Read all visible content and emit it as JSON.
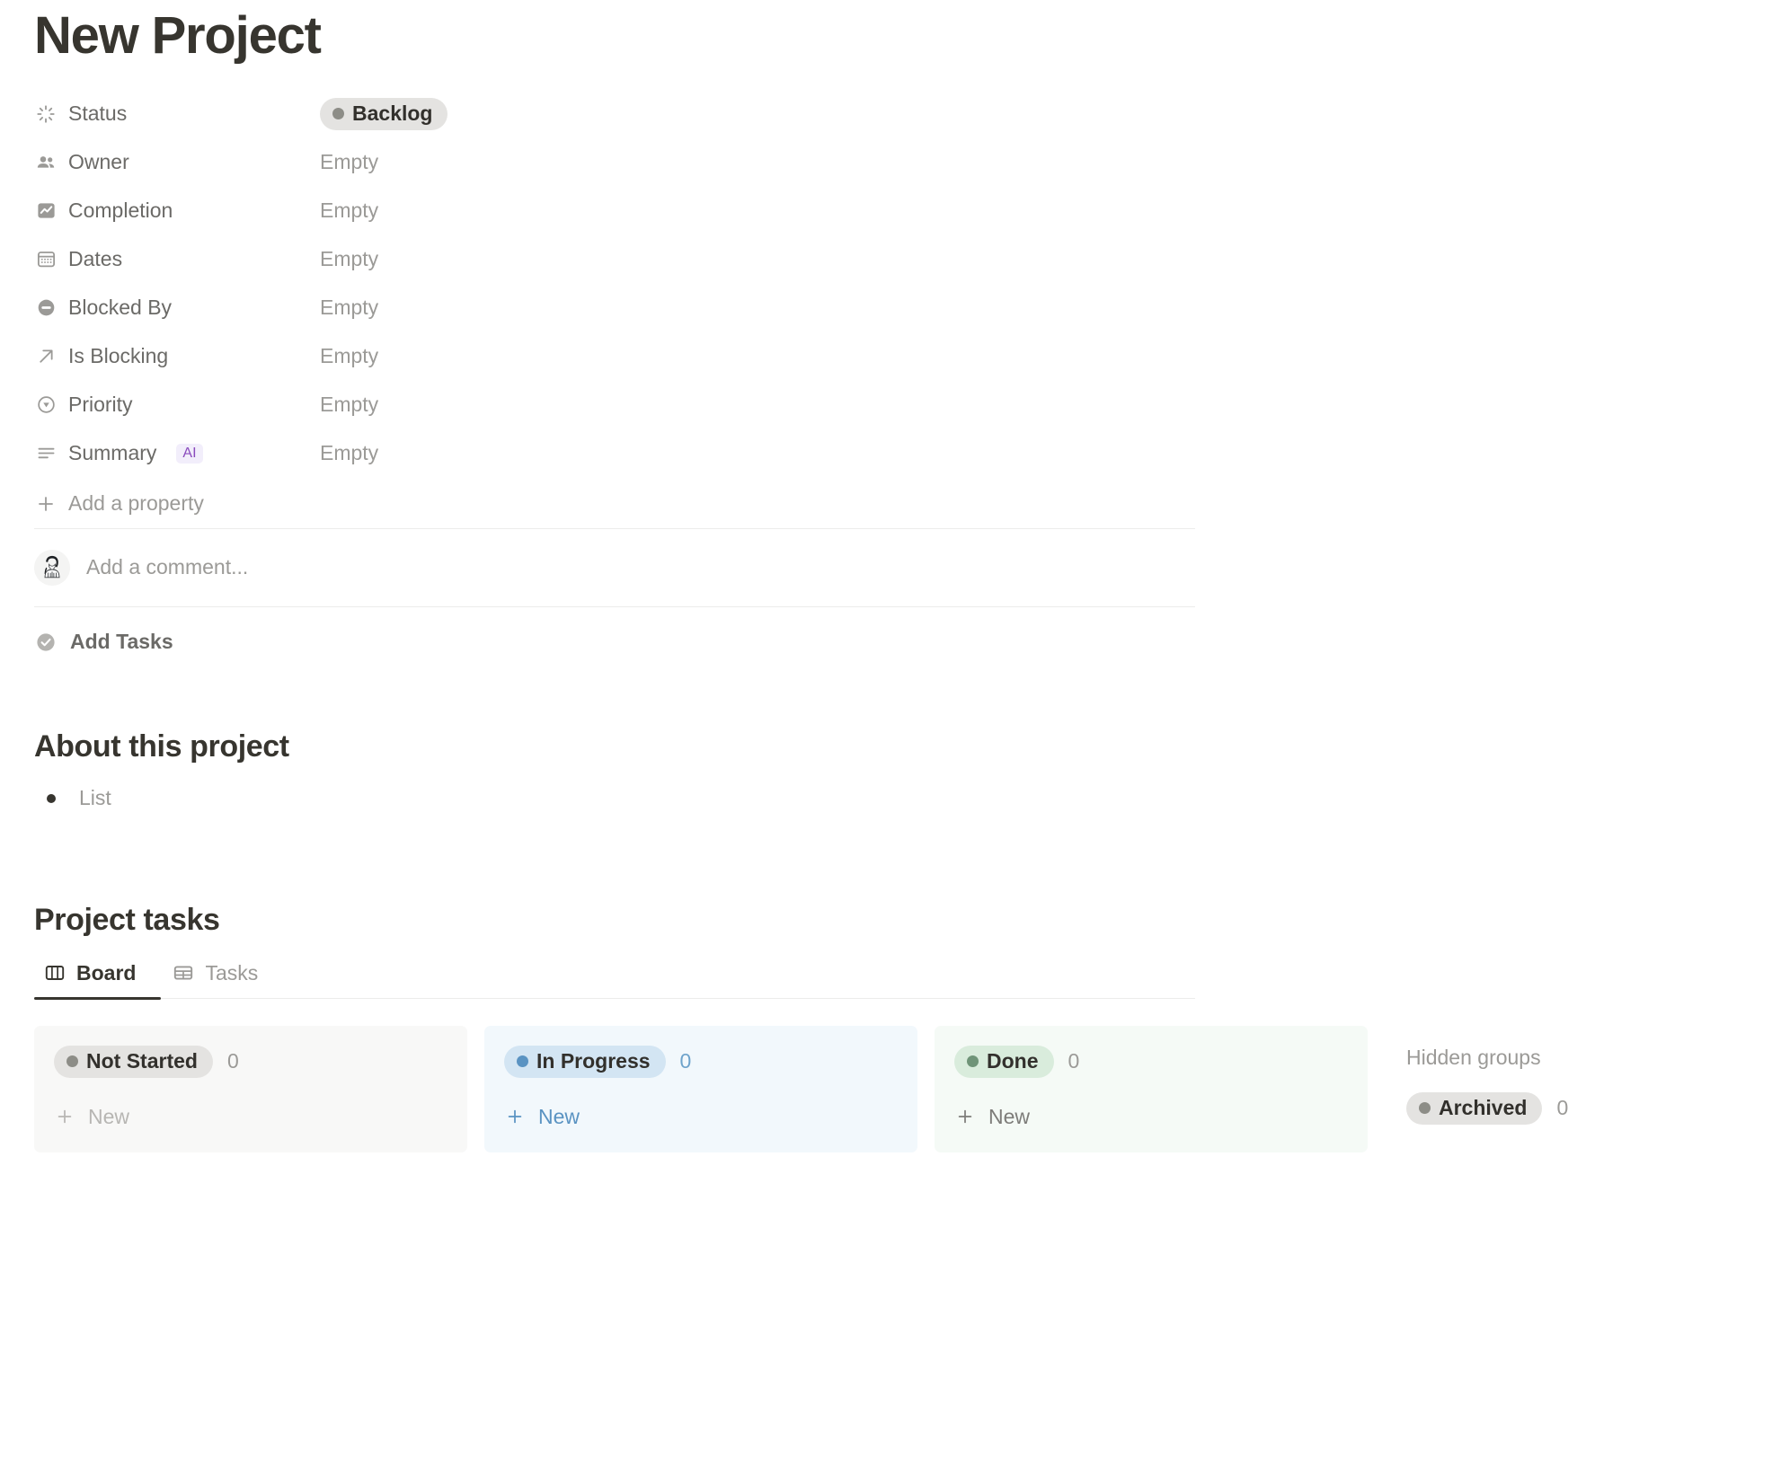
{
  "page": {
    "title": "New Project"
  },
  "properties": [
    {
      "icon": "loading-spinner-icon",
      "label": "Status",
      "value": "Backlog",
      "value_type": "pill",
      "pill_color": "gray"
    },
    {
      "icon": "people-icon",
      "label": "Owner",
      "value": "Empty",
      "value_type": "text"
    },
    {
      "icon": "chart-line-icon",
      "label": "Completion",
      "value": "Empty",
      "value_type": "text"
    },
    {
      "icon": "calendar-icon",
      "label": "Dates",
      "value": "Empty",
      "value_type": "text"
    },
    {
      "icon": "blocked-icon",
      "label": "Blocked By",
      "value": "Empty",
      "value_type": "text"
    },
    {
      "icon": "arrow-up-right-icon",
      "label": "Is Blocking",
      "value": "Empty",
      "value_type": "text"
    },
    {
      "icon": "priority-circle-icon",
      "label": "Priority",
      "value": "Empty",
      "value_type": "text"
    },
    {
      "icon": "text-lines-icon",
      "label": "Summary",
      "value": "Empty",
      "value_type": "text",
      "badge": "AI"
    }
  ],
  "add_property": {
    "label": "Add a property",
    "icon": "plus-icon"
  },
  "comment": {
    "placeholder": "Add a comment...",
    "avatar": "user-avatar"
  },
  "add_tasks": {
    "label": "Add Tasks",
    "icon": "check-circle-icon"
  },
  "about": {
    "heading": "About this project",
    "items": [
      "List"
    ]
  },
  "tasks": {
    "heading": "Project tasks",
    "tabs": [
      {
        "label": "Board",
        "icon": "board-columns-icon",
        "active": true
      },
      {
        "label": "Tasks",
        "icon": "table-grid-icon",
        "active": false
      }
    ],
    "columns": [
      {
        "label": "Not Started",
        "count": "0",
        "pill_color": "gray",
        "tint": "gray",
        "new_label": "New"
      },
      {
        "label": "In Progress",
        "count": "0",
        "pill_color": "blue",
        "tint": "blue",
        "new_label": "New"
      },
      {
        "label": "Done",
        "count": "0",
        "pill_color": "green",
        "tint": "green",
        "new_label": "New"
      }
    ],
    "hidden_groups": {
      "title": "Hidden groups",
      "items": [
        {
          "label": "Archived",
          "count": "0",
          "pill_color": "gray"
        }
      ]
    }
  },
  "colors": {
    "text_primary": "#37352f",
    "text_secondary": "#6b6a67",
    "text_muted": "#9b9a97",
    "pill_gray_bg": "#e4e3e1",
    "pill_blue_bg": "#d3e5f3",
    "pill_green_bg": "#d9ecdc",
    "col_blue_bg": "#f2f8fc",
    "col_green_bg": "#f5faf6",
    "col_gray_bg": "#f8f8f7",
    "ai_badge_text": "#8a4bbd",
    "ai_badge_bg": "#f2eefb",
    "link_blue": "#5a93c2"
  }
}
